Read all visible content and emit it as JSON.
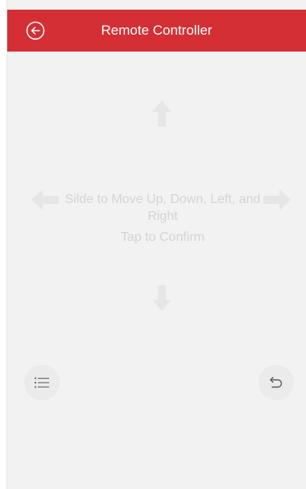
{
  "header": {
    "title": "Remote Controller",
    "back_icon": "back-circle-arrow-icon",
    "background_color": "#d32f35"
  },
  "touchpad": {
    "instruction_line_1": "Silde to Move Up, Down, Left, and Right",
    "instruction_line_2": "Tap to Confirm",
    "arrows": [
      "up-arrow-icon",
      "down-arrow-icon",
      "left-arrow-icon",
      "right-arrow-icon"
    ],
    "arrow_color": "#e6e6e6"
  },
  "footer": {
    "menu_icon": "list-menu-icon",
    "return_icon": "return-arrow-icon"
  }
}
